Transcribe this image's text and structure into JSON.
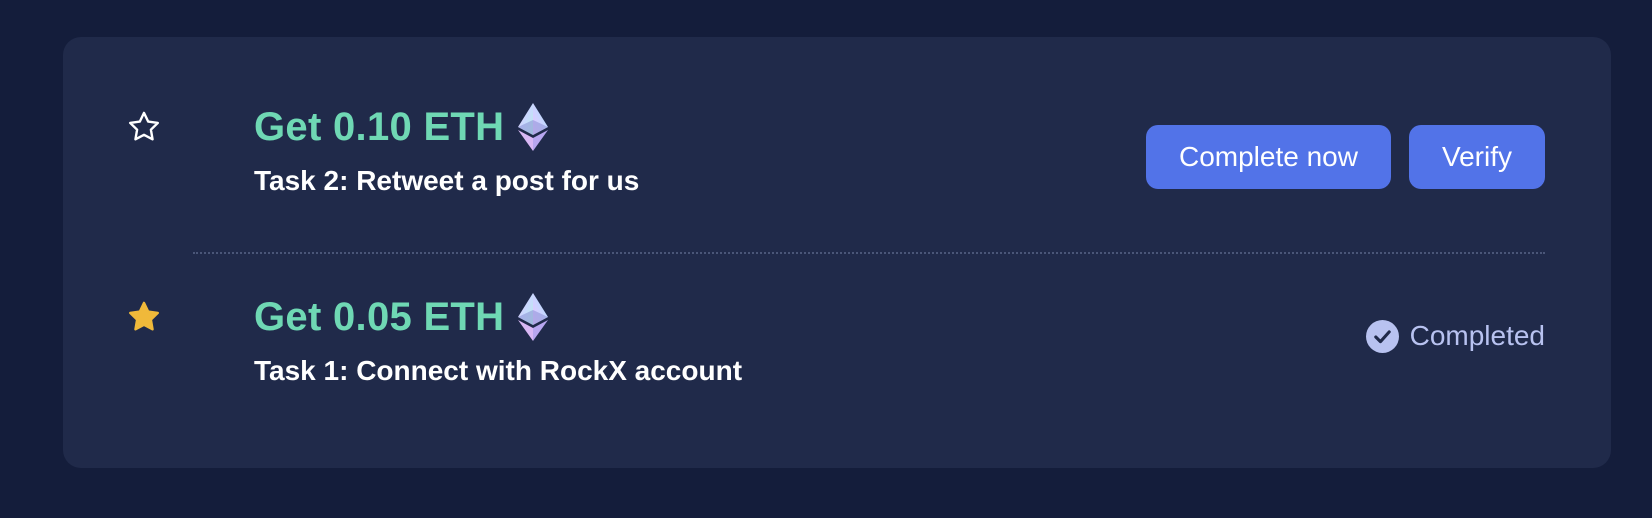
{
  "tasks": [
    {
      "reward": "Get 0.10 ETH",
      "title": "Task 2: Retweet a post for us",
      "star_state": "outline",
      "buttons": {
        "complete": "Complete now",
        "verify": "Verify"
      }
    },
    {
      "reward": "Get 0.05 ETH",
      "title": "Task 1: Connect with RockX account",
      "star_state": "filled",
      "status": "Completed"
    }
  ],
  "icons": {
    "star_outline": "star-outline-icon",
    "star_filled": "star-filled-icon",
    "eth": "ethereum-icon",
    "check": "check-circle-icon"
  },
  "colors": {
    "background": "#141d3b",
    "card": "#202a4a",
    "reward": "#6fd8b4",
    "button": "#5273e8",
    "star_filled": "#f0b93a",
    "status": "#b8c2f0"
  }
}
